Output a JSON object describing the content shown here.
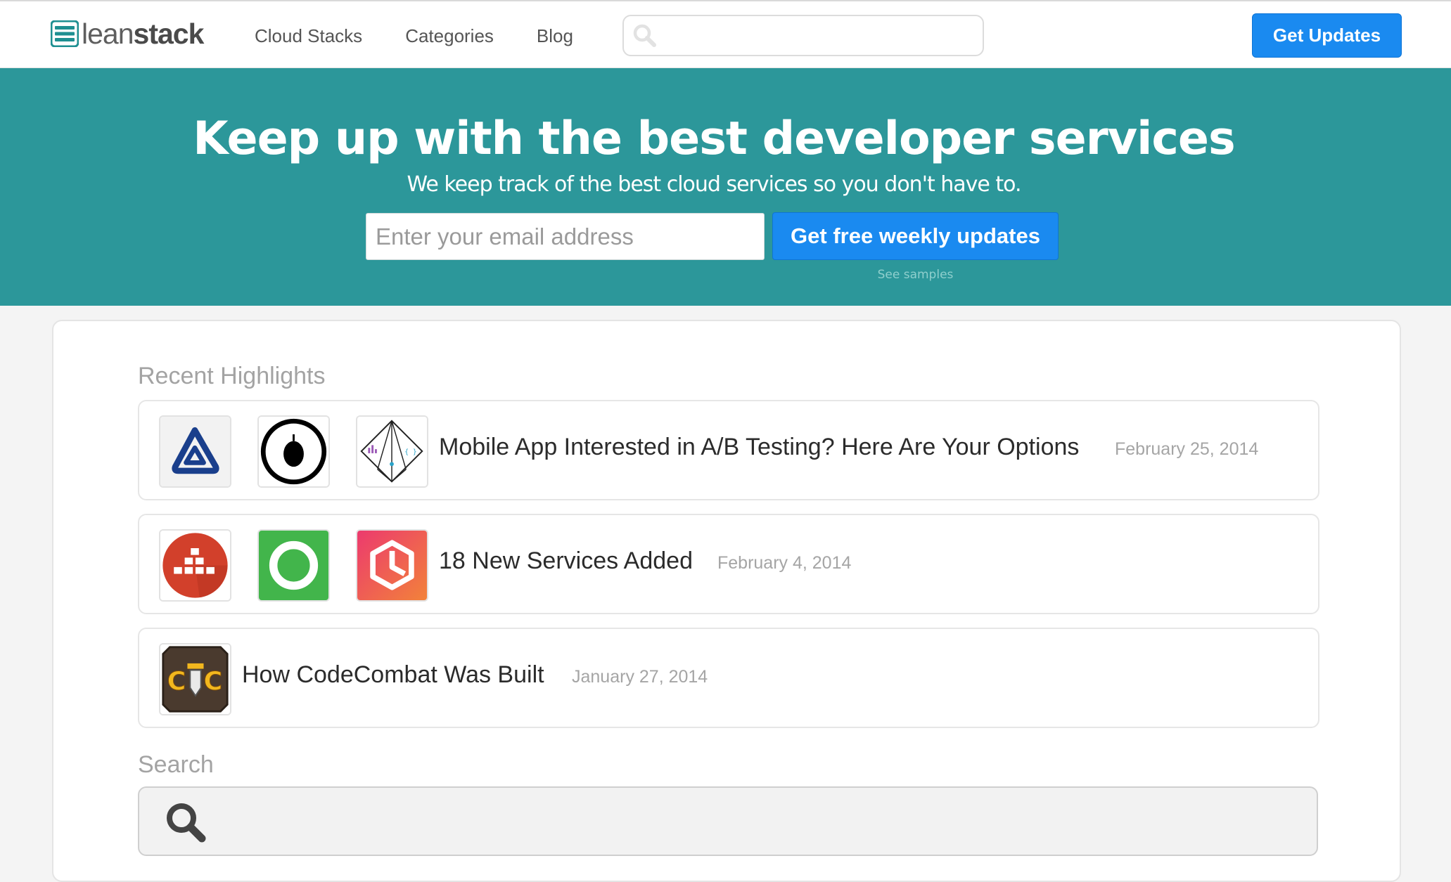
{
  "nav": {
    "logo_lean": "lean",
    "logo_stack": "stack",
    "links": [
      "Cloud Stacks",
      "Categories",
      "Blog"
    ],
    "search_value": "",
    "get_updates": "Get Updates"
  },
  "hero": {
    "title": "Keep up with the best developer services",
    "subtitle": "We keep track of the best cloud services so you don't have to.",
    "email_placeholder": "Enter your email address",
    "button": "Get free weekly updates",
    "samples_link": "See samples"
  },
  "recent": {
    "heading": "Recent Highlights",
    "items": [
      {
        "title": "Mobile App Interested in A/B Testing? Here Are Your Options",
        "date": "February 25, 2014",
        "icons": [
          "a-triangle-logo-icon",
          "black-circle-logo-icon",
          "diamond-prism-logo-icon"
        ]
      },
      {
        "title": "18 New Services Added",
        "date": "February 4, 2014",
        "icons": [
          "red-blocks-logo-icon",
          "green-ring-logo-icon",
          "pink-hexagon-logo-icon"
        ]
      },
      {
        "title": "How CodeCombat Was Built",
        "date": "January 27, 2014",
        "icons": [
          "codecombat-logo-icon"
        ]
      }
    ]
  },
  "search": {
    "heading": "Search",
    "value": ""
  },
  "colors": {
    "hero_bg": "#2c979a",
    "primary_button": "#1a8af0",
    "logo_teal": "#1e8f91"
  }
}
